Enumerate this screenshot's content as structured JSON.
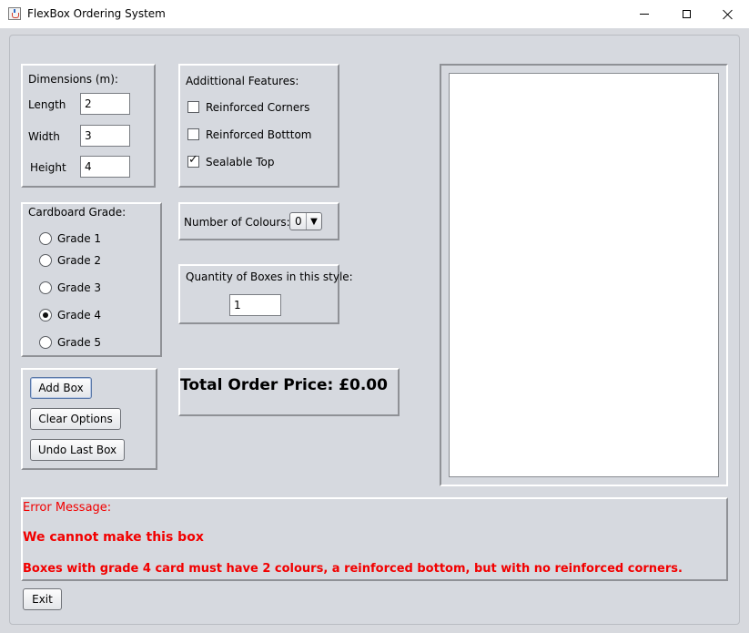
{
  "window": {
    "title": "FlexBox Ordering System",
    "app_icon": "java-cup-icon",
    "min_icon": "minimize-icon",
    "max_icon": "maximize-icon",
    "close_icon": "close-icon"
  },
  "dimensions": {
    "heading": "Dimensions (m):",
    "length_label": "Length",
    "length_value": "2",
    "width_label": "Width",
    "width_value": "3",
    "height_label": "Height",
    "height_value": "4"
  },
  "features": {
    "heading": "Addittional Features:",
    "items": [
      {
        "label": "Reinforced Corners",
        "checked": false
      },
      {
        "label": "Reinforced Botttom",
        "checked": false
      },
      {
        "label": "Sealable Top",
        "checked": true
      }
    ]
  },
  "grade": {
    "heading": "Cardboard Grade:",
    "options": [
      {
        "label": "Grade 1",
        "selected": false
      },
      {
        "label": "Grade 2",
        "selected": false
      },
      {
        "label": "Grade 3",
        "selected": false
      },
      {
        "label": "Grade 4",
        "selected": true
      },
      {
        "label": "Grade 5",
        "selected": false
      }
    ]
  },
  "colours": {
    "label": "Number of Colours:",
    "selected": "0"
  },
  "quantity": {
    "label": "Quantity of Boxes in this style:",
    "value": "1"
  },
  "actions": {
    "add_label": "Add Box",
    "clear_label": "Clear Options",
    "undo_label": "Undo Last Box"
  },
  "total": {
    "text": "Total Order Price: £0.00"
  },
  "error": {
    "heading": "Error Message:",
    "line1": "We cannot make this box",
    "line2": "Boxes with grade 4 card must have 2 colours, a reinforced bottom, but with no reinforced corners."
  },
  "footer": {
    "exit_label": "Exit"
  },
  "colors": {
    "background": "#d6d9df",
    "error_text": "#f20000"
  }
}
